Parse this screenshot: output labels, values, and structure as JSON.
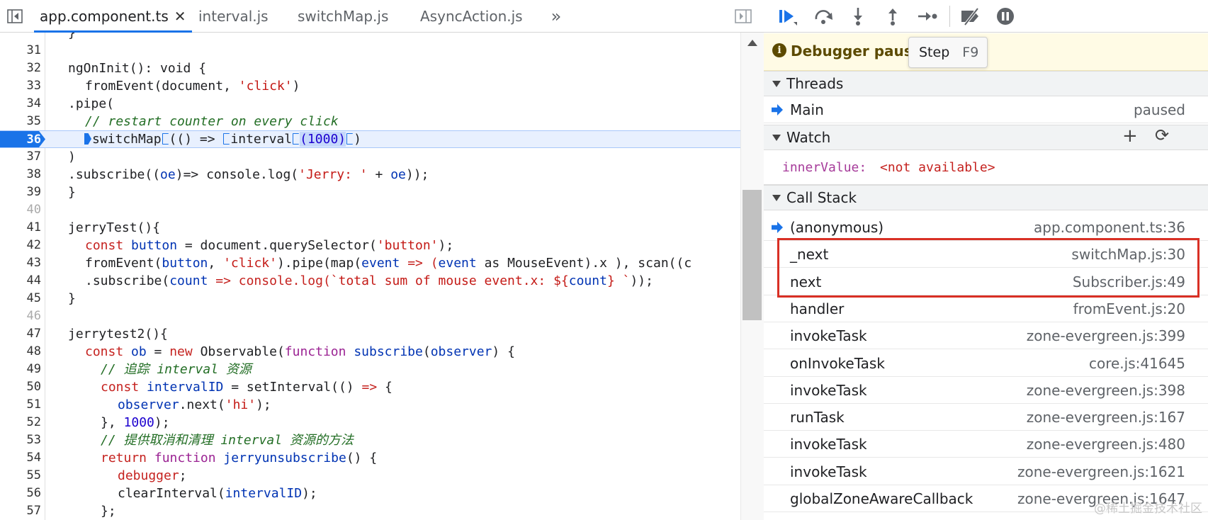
{
  "editor": {
    "tabs": [
      {
        "label": "app.component.ts",
        "active": true,
        "closable": true
      },
      {
        "label": "interval.js",
        "active": false
      },
      {
        "label": "switchMap.js",
        "active": false
      },
      {
        "label": "AsyncAction.js",
        "active": false
      }
    ],
    "more_tabs_icon": "double-chevron-right-icon",
    "lines": [
      {
        "n": "31",
        "dim": false
      },
      {
        "n": "32",
        "dim": false
      },
      {
        "n": "33",
        "dim": false
      },
      {
        "n": "34",
        "dim": false
      },
      {
        "n": "35",
        "dim": false
      },
      {
        "n": "36",
        "dim": false,
        "exec": true
      },
      {
        "n": "37",
        "dim": false
      },
      {
        "n": "38",
        "dim": false
      },
      {
        "n": "39",
        "dim": false
      },
      {
        "n": "40",
        "dim": true
      },
      {
        "n": "41",
        "dim": false
      },
      {
        "n": "42",
        "dim": false
      },
      {
        "n": "43",
        "dim": false
      },
      {
        "n": "44",
        "dim": false
      },
      {
        "n": "45",
        "dim": false
      },
      {
        "n": "46",
        "dim": true
      },
      {
        "n": "47",
        "dim": false
      },
      {
        "n": "48",
        "dim": false
      },
      {
        "n": "49",
        "dim": false
      },
      {
        "n": "50",
        "dim": false
      },
      {
        "n": "51",
        "dim": false
      },
      {
        "n": "52",
        "dim": false
      },
      {
        "n": "53",
        "dim": false
      },
      {
        "n": "54",
        "dim": false
      },
      {
        "n": "55",
        "dim": false
      },
      {
        "n": "56",
        "dim": false
      },
      {
        "n": "57",
        "dim": false
      }
    ],
    "code": {
      "l32": "ngOnInit(): void {",
      "l33a": "fromEvent(document, ",
      "l33b": "'click'",
      "l33c": ")",
      "l34": ".pipe(",
      "l35": "// restart counter on every click",
      "l36a": "switchMap",
      "l36b": "(() => ",
      "l36c": "interval",
      "l36d": "(1000)",
      "l36e": ")",
      "l37": ")",
      "l38a": ".subscribe((",
      "l38b": "oe",
      "l38c": ")=> console.log(",
      "l38d": "'Jerry: '",
      "l38e": " + ",
      "l38f": "oe",
      "l38g": "));",
      "l39": "}",
      "l41": "jerryTest(){",
      "l42a": "const",
      "l42b": " button",
      "l42c": " = document.querySelector(",
      "l42d": "'button'",
      "l42e": ");",
      "l43a": "fromEvent(",
      "l43b": "button",
      "l43c": ", ",
      "l43d": "'click'",
      "l43e": ").pipe(map(",
      "l43f": "event",
      "l43g": " => (",
      "l43h": "event",
      "l43i": " as MouseEvent).x ), scan((c",
      "l44a": ".subscribe(",
      "l44b": "count",
      "l44c": " => console.log(",
      "l44d": "`total sum of mouse event.x: ${",
      "l44e": "count",
      "l44f": "} `",
      "l44g": "));",
      "l45": "}",
      "l47": "jerrytest2(){",
      "l48a": "const",
      "l48b": " ob",
      "l48c": " = ",
      "l48d": "new",
      "l48e": " Observable(",
      "l48f": "function",
      "l48g": " subscribe",
      "l48h": "(",
      "l48i": "observer",
      "l48j": ") {",
      "l49": "// 追踪 interval 资源",
      "l50a": "const",
      "l50b": " intervalID",
      "l50c": " = setInterval(() ",
      "l50d": "=>",
      "l50e": " {",
      "l51a": "observer",
      "l51b": ".next(",
      "l51c": "'hi'",
      "l51d": ");",
      "l52a": "}, ",
      "l52b": "1000",
      "l52c": ");",
      "l53": "// 提供取消和清理 interval 资源的方法",
      "l54a": "return",
      "l54b": " function",
      "l54c": " jerryunsubscribe",
      "l54d": "() {",
      "l55a": "debugger",
      "l55b": ";",
      "l56a": "clearInterval(",
      "l56b": "intervalID",
      "l56c": ");",
      "l57": "};"
    }
  },
  "debugger": {
    "toolbar_icons": [
      "resume-icon",
      "step-over-icon",
      "step-into-icon",
      "step-out-icon",
      "step-icon",
      "deactivate-breakpoints-icon",
      "pause-on-exceptions-icon"
    ],
    "banner_text": "Debugger pause",
    "tooltip": {
      "label": "Step",
      "key": "F9"
    },
    "threads": {
      "title": "Threads",
      "items": [
        {
          "name": "Main",
          "status": "paused"
        }
      ]
    },
    "watch": {
      "title": "Watch",
      "name": "innerValue:",
      "value": "<not available>"
    },
    "callstack": {
      "title": "Call Stack",
      "frames": [
        {
          "name": "(anonymous)",
          "loc": "app.component.ts:36",
          "current": true
        },
        {
          "name": "_next",
          "loc": "switchMap.js:30"
        },
        {
          "name": "next",
          "loc": "Subscriber.js:49"
        },
        {
          "name": "handler",
          "loc": "fromEvent.js:20"
        },
        {
          "name": "invokeTask",
          "loc": "zone-evergreen.js:399"
        },
        {
          "name": "onInvokeTask",
          "loc": "core.js:41645"
        },
        {
          "name": "invokeTask",
          "loc": "zone-evergreen.js:398"
        },
        {
          "name": "runTask",
          "loc": "zone-evergreen.js:167"
        },
        {
          "name": "invokeTask",
          "loc": "zone-evergreen.js:480"
        },
        {
          "name": "invokeTask",
          "loc": "zone-evergreen.js:1621"
        },
        {
          "name": "globalZoneAwareCallback",
          "loc": "zone-evergreen.js:1647"
        }
      ]
    }
  },
  "watermark": "@稀土掘金技术社区",
  "colors": {
    "accent": "#1a73e8",
    "highlight_box": "#d93025",
    "banner_bg": "#fffbe5"
  }
}
